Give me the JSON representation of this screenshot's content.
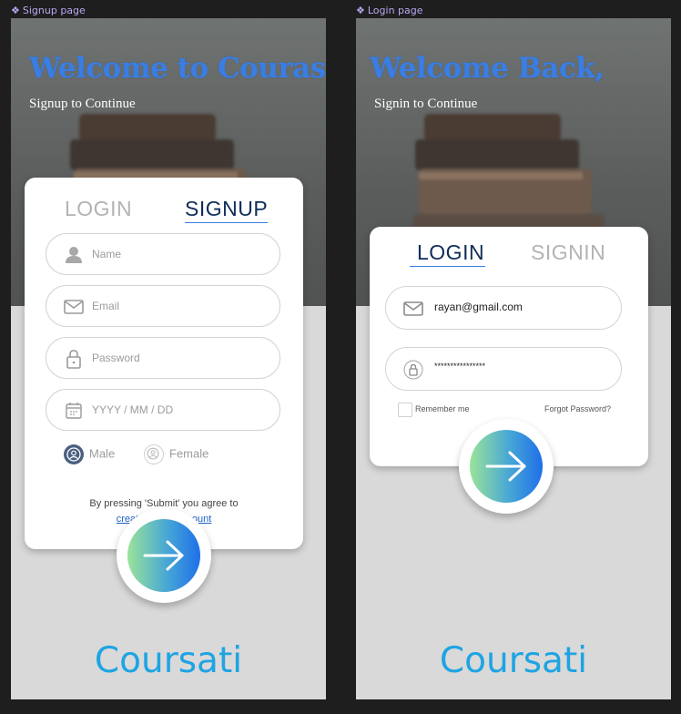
{
  "frames": {
    "signup_label": "Signup page",
    "login_label": "Login page"
  },
  "signup": {
    "title": "Welcome to Courasti,",
    "subtitle": "Signup to Continue",
    "tab_login": "LOGIN",
    "tab_signup": "SIGNUP",
    "name_placeholder": "Name",
    "email_placeholder": "Email",
    "password_placeholder": "Password",
    "date_placeholder": "YYYY / MM / DD",
    "gender_male": "Male",
    "gender_female": "Female",
    "terms_text": "By pressing 'Submit' you agree to",
    "terms_link": "create a new account",
    "brand": "Coursati"
  },
  "login": {
    "title": "Welcome Back,",
    "subtitle": "Signin to Continue",
    "tab_login": "LOGIN",
    "tab_signin": "SIGNIN",
    "email_value": "rayan@gmail.com",
    "password_value": "****************",
    "remember_me": "Remember me",
    "forgot_password": "Forgot Password?",
    "brand": "Coursati"
  },
  "colors": {
    "title_blue": "#3a7ee3",
    "brand_blue": "#1ea4e3",
    "active_tab": "#0f2d5a"
  }
}
